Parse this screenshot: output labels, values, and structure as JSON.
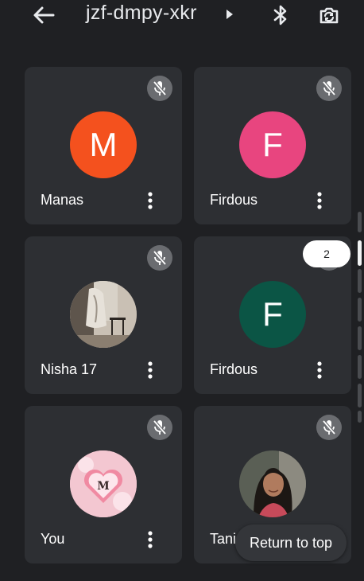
{
  "header": {
    "meeting_code": "jzf-dmpy-xkr",
    "icons": [
      "arrow-back-icon",
      "caret-right-icon",
      "bluetooth-icon",
      "switch-camera-icon"
    ]
  },
  "participants": [
    {
      "name": "Manas",
      "initial": "M",
      "avatar_color": "#f4511e",
      "muted": true
    },
    {
      "name": "Firdous",
      "initial": "F",
      "avatar_color": "#e8457f",
      "muted": true
    },
    {
      "name": "Nisha 17",
      "initial": "",
      "avatar_color": "#7a6f65",
      "muted": true
    },
    {
      "name": "Firdous",
      "initial": "F",
      "avatar_color": "#0b5545",
      "muted": true
    },
    {
      "name": "You",
      "initial": "",
      "avatar_color": "#f6c4cf",
      "muted": true
    },
    {
      "name": "Tania",
      "initial": "",
      "avatar_color": "#3a3f37",
      "muted": true
    }
  ],
  "page_indicator": {
    "page": "2"
  },
  "return_to_top": {
    "label": "Return to top"
  },
  "avatar_art": {
    "you_monogram": "M"
  },
  "colors": {
    "background": "#1f2023",
    "tile": "#2d2f33",
    "mute_badge": "#6a6c70",
    "scroll_thumb": "#f1f3f4"
  }
}
